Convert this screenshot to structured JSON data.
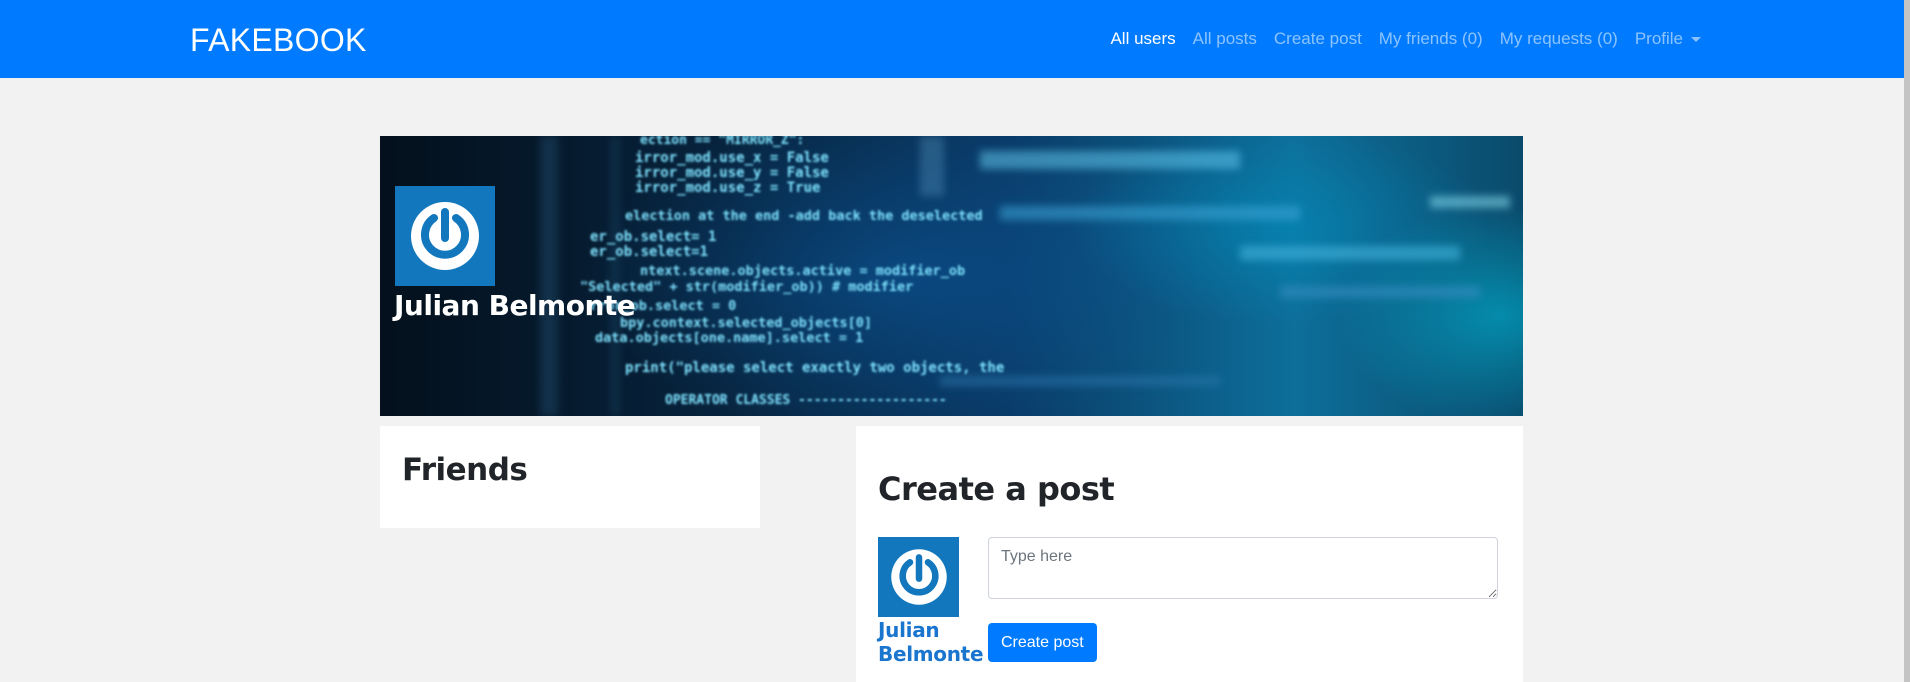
{
  "navbar": {
    "brand": "FAKEBOOK",
    "links": [
      {
        "label": "All users",
        "active": true
      },
      {
        "label": "All posts",
        "active": false
      },
      {
        "label": "Create post",
        "active": false
      },
      {
        "label": "My friends (0)",
        "active": false
      },
      {
        "label": "My requests (0)",
        "active": false
      },
      {
        "label": "Profile",
        "active": false,
        "dropdown": true
      }
    ],
    "background_color": "#007bff"
  },
  "cover": {
    "user_name": "Julian Belmonte",
    "avatar_icon": "power-icon",
    "code_lines": [
      "ection == \"MIRROR_Z\":",
      "irror_mod.use_x = False",
      "irror_mod.use_y = False",
      "irror_mod.use_z = True",
      "election at the end -add back the deselected",
      "er_ob.select= 1",
      "er_ob.select=1",
      "ntext.scene.objects.active = modifier_ob",
      "\"Selected\" + str(modifier_ob)) # modifier",
      "rror_ob.select = 0",
      "bpy.context.selected_objects[0]",
      "data.objects[one.name].select = 1",
      "print(\"please select exactly two objects, the",
      "OPERATOR CLASSES -------------------"
    ]
  },
  "friends": {
    "title": "Friends"
  },
  "create_post": {
    "title": "Create a post",
    "author_name": "Julian Belmonte",
    "textarea_placeholder": "Type here",
    "button_label": "Create post"
  },
  "colors": {
    "accent": "#007bff",
    "avatar_bg": "#1277bd",
    "page_bg": "#f2f2f2"
  }
}
